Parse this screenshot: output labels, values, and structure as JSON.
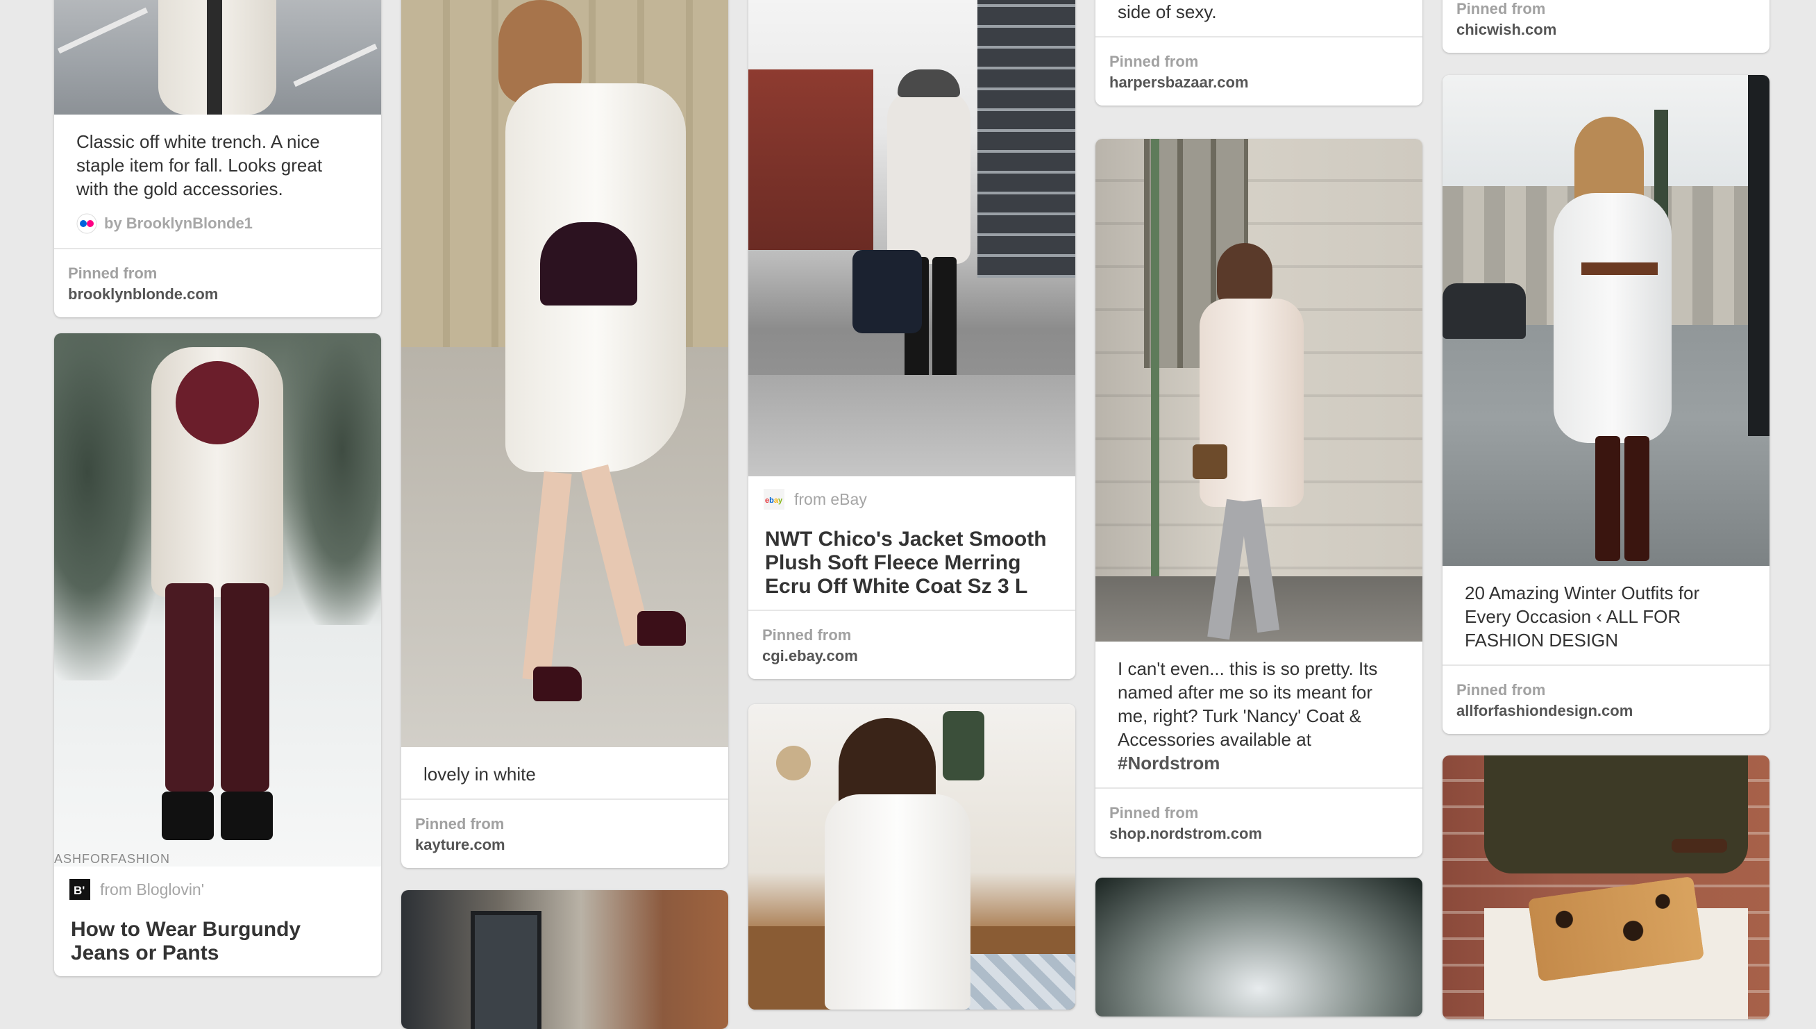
{
  "col1": {
    "trench": {
      "desc": "Classic off white trench. A nice staple item for fall. Looks great with the gold accessories.",
      "by": "by BrooklynBlonde1",
      "pinned_label": "Pinned from",
      "domain": "brooklynblonde.com"
    },
    "burgundy": {
      "watermark": "ASHFORFASHION",
      "source": "from Bloglovin'",
      "title": "How to Wear Burgundy Jeans or Pants"
    }
  },
  "col2": {
    "white": {
      "desc": "lovely in white",
      "pinned_label": "Pinned from",
      "domain": "kayture.com"
    }
  },
  "col3": {
    "ebay": {
      "source": "from eBay",
      "title": "NWT Chico's Jacket Smooth Plush Soft Fleece Merring Ecru Off White Coat Sz 3 L",
      "pinned_label": "Pinned from",
      "domain": "cgi.ebay.com"
    }
  },
  "col4": {
    "harpers": {
      "desc_tail": "silhouette can come with a serious side of sexy.",
      "pinned_label": "Pinned from",
      "domain": "harpersbazaar.com"
    },
    "nancy": {
      "desc": "I can't even... this is so pretty. Its named after me so its meant for me, right? Turk 'Nancy' Coat & Accessories available at",
      "hashtag": "#Nordstrom",
      "pinned_label": "Pinned from",
      "domain": "shop.nordstrom.com"
    }
  },
  "col5": {
    "chicwish": {
      "pinned_label": "Pinned from",
      "domain": "chicwish.com"
    },
    "winter": {
      "desc": "20 Amazing Winter Outfits for Every Occasion ‹ ALL FOR FASHION DESIGN",
      "pinned_label": "Pinned from",
      "domain": "allforfashiondesign.com"
    }
  },
  "colors": {
    "background": "#e9e9e9",
    "card": "#ffffff",
    "source_text": "#555555",
    "muted_text": "#a1a1a1"
  }
}
